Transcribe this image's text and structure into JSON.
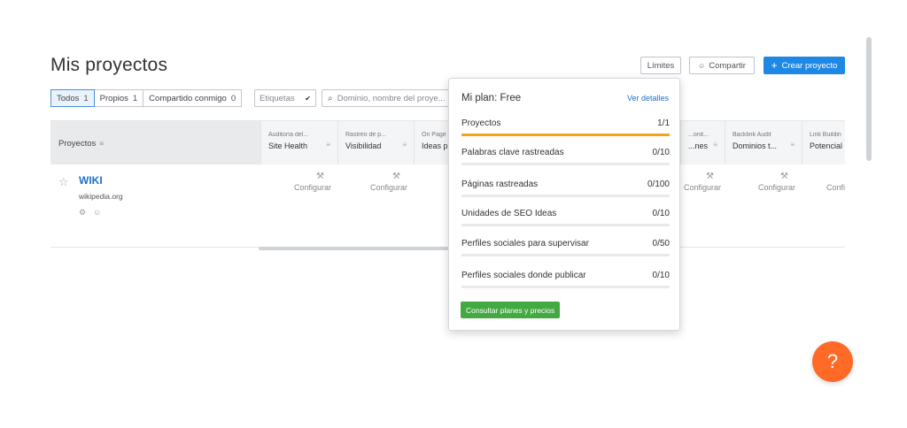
{
  "page": {
    "title": "Mis proyectos"
  },
  "toolbar": {
    "limits_label": "Límites",
    "share_label": "Compartir",
    "create_label": "Crear proyecto"
  },
  "filters": [
    {
      "label": "Todos",
      "count": "1",
      "active": true
    },
    {
      "label": "Propios",
      "count": "1",
      "active": false
    },
    {
      "label": "Compartido conmigo",
      "count": "0",
      "active": false
    }
  ],
  "tags": {
    "label": "Etiquetas"
  },
  "search": {
    "placeholder": "Dominio, nombre del proye..."
  },
  "table": {
    "projects_header": "Proyectos",
    "columns": [
      {
        "small": "Auditoría del...",
        "big": "Site Health"
      },
      {
        "small": "Rastreo de p...",
        "big": "Visibilidad"
      },
      {
        "small": "On Page",
        "big": "Ideas p"
      },
      {
        "small": "...onit...",
        "big": "...nes"
      },
      {
        "small": "Backlink Audit",
        "big": "Dominios t..."
      },
      {
        "small": "Link Buildin",
        "big": "Potencial"
      }
    ],
    "row": {
      "name": "WIKI",
      "domain": "wikipedia.org",
      "configure_label": "Configurar"
    }
  },
  "plan_popup": {
    "title": "Mi plan: Free",
    "details_link": "Ver detalles",
    "limits": [
      {
        "label": "Proyectos",
        "used": "1",
        "total": "1",
        "fraction": 1.0
      },
      {
        "label": "Palabras clave rastreadas",
        "used": "0",
        "total": "10",
        "fraction": 0
      },
      {
        "label": "Páginas rastreadas",
        "used": "0",
        "total": "100",
        "fraction": 0
      },
      {
        "label": "Unidades de SEO Ideas",
        "used": "0",
        "total": "10",
        "fraction": 0
      },
      {
        "label": "Perfiles sociales para supervisar",
        "used": "0",
        "total": "50",
        "fraction": 0
      },
      {
        "label": "Perfiles sociales donde publicar",
        "used": "0",
        "total": "10",
        "fraction": 0
      }
    ],
    "cta_label": "Consultar planes y precios"
  },
  "help": {
    "label": "?"
  },
  "colors": {
    "accent": "#1e88e5",
    "progress": "#f2a51a",
    "cta": "#43a942",
    "help": "#ff6a26"
  }
}
